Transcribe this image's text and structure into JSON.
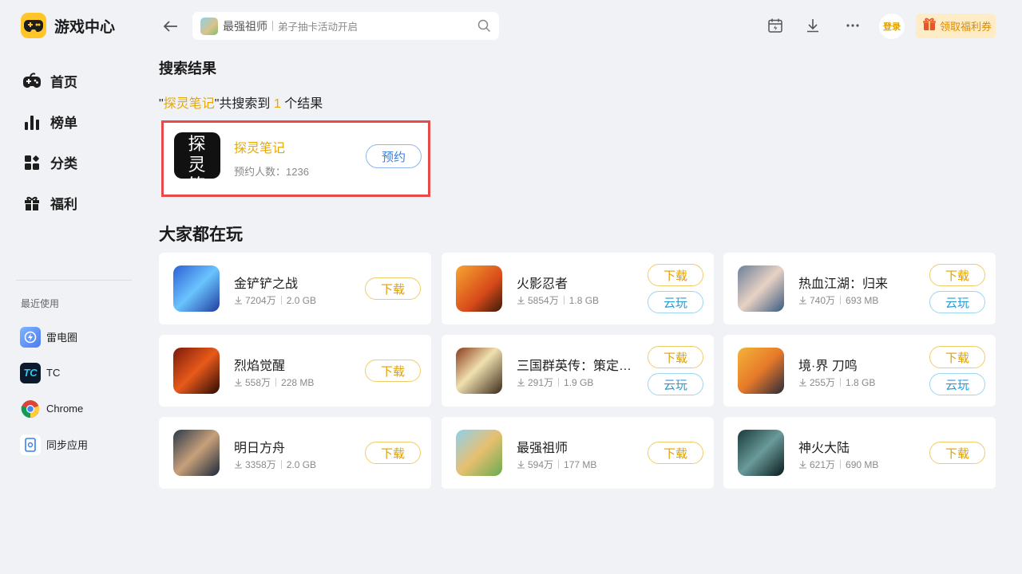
{
  "app": {
    "title": "游戏中心"
  },
  "nav": [
    {
      "label": "首页",
      "icon": "gamepad-icon"
    },
    {
      "label": "榜单",
      "icon": "ranking-icon"
    },
    {
      "label": "分类",
      "icon": "category-icon"
    },
    {
      "label": "福利",
      "icon": "gift-icon"
    }
  ],
  "recent": {
    "title": "最近使用",
    "items": [
      {
        "label": "雷电圈",
        "icon": "leidian-circle-icon"
      },
      {
        "label": "TC",
        "icon": "tc-icon"
      },
      {
        "label": "Chrome",
        "icon": "chrome-icon"
      },
      {
        "label": "同步应用",
        "icon": "sync-app-icon"
      }
    ]
  },
  "search": {
    "game": "最强祖师",
    "hint": "弟子抽卡活动开启"
  },
  "topbar": {
    "login": "登录",
    "coupon": "领取福利券"
  },
  "results": {
    "title": "搜索结果",
    "quote_open": "\"",
    "keyword": "探灵笔记",
    "mid": "\"共搜索到 ",
    "count": "1",
    "tail": " 个结果",
    "item": {
      "name": "探灵笔记",
      "meta": "预约人数：1236",
      "button": "预约",
      "icon_text": "探灵笔记"
    }
  },
  "popular": {
    "title": "大家都在玩",
    "games": [
      {
        "name": "金铲铲之战",
        "downloads": "7204万",
        "size": "2.0 GB",
        "download": "下载",
        "cloud": ""
      },
      {
        "name": "火影忍者",
        "downloads": "5854万",
        "size": "1.8 GB",
        "download": "下载",
        "cloud": "云玩"
      },
      {
        "name": "热血江湖：归来",
        "downloads": "740万",
        "size": "693 MB",
        "download": "下载",
        "cloud": "云玩"
      },
      {
        "name": "烈焰觉醒",
        "downloads": "558万",
        "size": "228 MB",
        "download": "下载",
        "cloud": ""
      },
      {
        "name": "三国群英传：策定九州",
        "downloads": "291万",
        "size": "1.9 GB",
        "download": "下载",
        "cloud": "云玩"
      },
      {
        "name": "境·界 刀鸣",
        "downloads": "255万",
        "size": "1.8 GB",
        "download": "下载",
        "cloud": "云玩"
      },
      {
        "name": "明日方舟",
        "downloads": "3358万",
        "size": "2.0 GB",
        "download": "下载",
        "cloud": ""
      },
      {
        "name": "最强祖师",
        "downloads": "594万",
        "size": "177 MB",
        "download": "下载",
        "cloud": ""
      },
      {
        "name": "神火大陆",
        "downloads": "621万",
        "size": "690 MB",
        "download": "下载",
        "cloud": ""
      }
    ]
  },
  "colors": {
    "accent": "#e8a800",
    "highlight_border": "#e8494b",
    "cloud": "#2b9bd3",
    "reserve": "#3a7de0"
  }
}
